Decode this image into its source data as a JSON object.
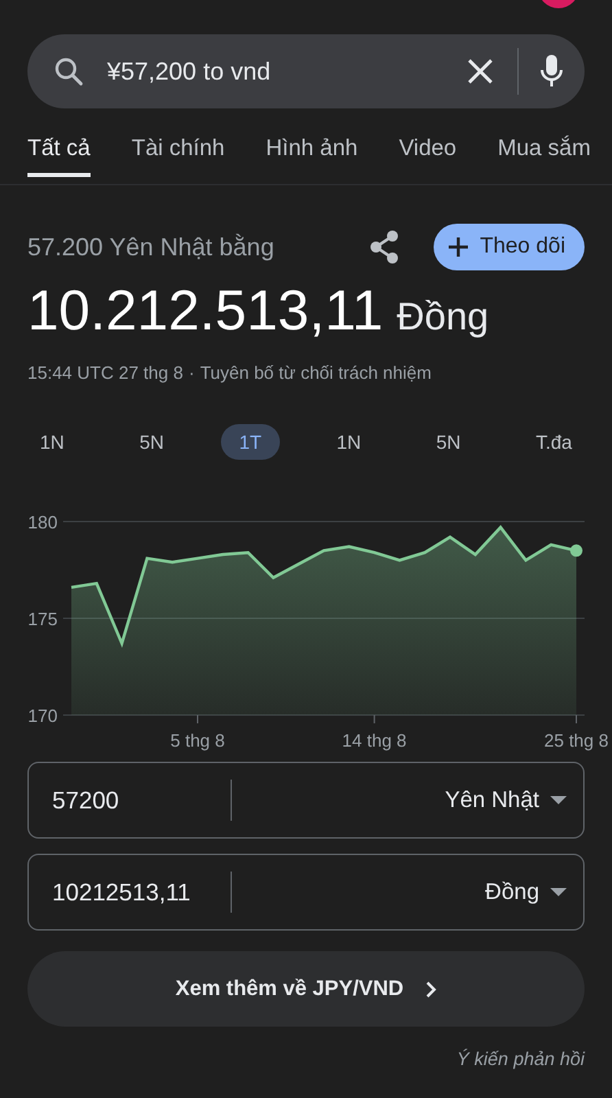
{
  "search": {
    "value": "¥57,200 to vnd"
  },
  "tabs": [
    {
      "label": "Tất cả",
      "selected": true
    },
    {
      "label": "Tài chính",
      "selected": false
    },
    {
      "label": "Hình ảnh",
      "selected": false
    },
    {
      "label": "Video",
      "selected": false
    },
    {
      "label": "Mua sắm",
      "selected": false
    }
  ],
  "result": {
    "subtitle": "57.200 Yên Nhật bằng",
    "follow_button": "Theo dõi",
    "amount": "10.212.513,11",
    "currency": "Đồng",
    "timestamp": "15:44 UTC 27 thg 8",
    "separator": "·",
    "disclaimer": "Tuyên bố từ chối trách nhiệm"
  },
  "ranges": [
    {
      "label": "1N",
      "selected": false
    },
    {
      "label": "5N",
      "selected": false
    },
    {
      "label": "1T",
      "selected": true
    },
    {
      "label": "1N",
      "selected": false
    },
    {
      "label": "5N",
      "selected": false
    },
    {
      "label": "T.đa",
      "selected": false
    }
  ],
  "chart": {
    "chart_data": {
      "type": "area",
      "categories": [
        null,
        null,
        null,
        null,
        null,
        "5 thg 8",
        null,
        null,
        null,
        null,
        null,
        null,
        "14 thg 8",
        null,
        null,
        null,
        null,
        null,
        null,
        null,
        "25 thg 8"
      ],
      "series": [
        {
          "color": "#81c995",
          "values": [
            176.6,
            176.8,
            173.7,
            178.1,
            177.9,
            178.1,
            178.3,
            178.4,
            177.1,
            177.8,
            178.5,
            178.7,
            178.4,
            178.0,
            178.4,
            179.2,
            178.3,
            179.7,
            178.0,
            178.8,
            178.5
          ]
        }
      ],
      "ylim": [
        170,
        180
      ],
      "yticks": [
        170,
        175,
        180
      ]
    }
  },
  "converter": [
    {
      "value": "57200",
      "currency": "Yên Nhật"
    },
    {
      "value": "10212513,11",
      "currency": "Đồng"
    }
  ],
  "more_button": "Xem thêm về JPY/VND",
  "feedback_link": "Ý kiến phản hồi"
}
